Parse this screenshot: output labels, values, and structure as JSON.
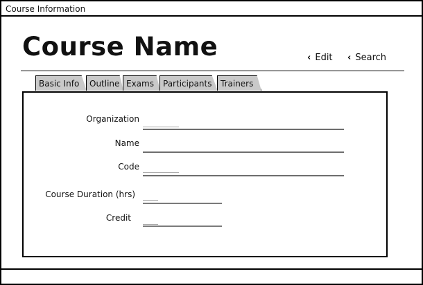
{
  "window": {
    "title": "Course Information"
  },
  "header": {
    "course_name": "Course Name",
    "edit_label": "Edit",
    "search_label": "Search"
  },
  "tabs": [
    {
      "label": "Basic Info"
    },
    {
      "label": "Outline"
    },
    {
      "label": "Exams"
    },
    {
      "label": "Participants"
    },
    {
      "label": "Trainers"
    }
  ],
  "form": {
    "organization_label": "Organization",
    "name_label": "Name",
    "code_label": "Code",
    "duration_label": "Course Duration (hrs)",
    "credit_label": "Credit"
  },
  "colors": {
    "tab_bg": "#c9c9c9",
    "field_line": "#6d6d6d"
  }
}
